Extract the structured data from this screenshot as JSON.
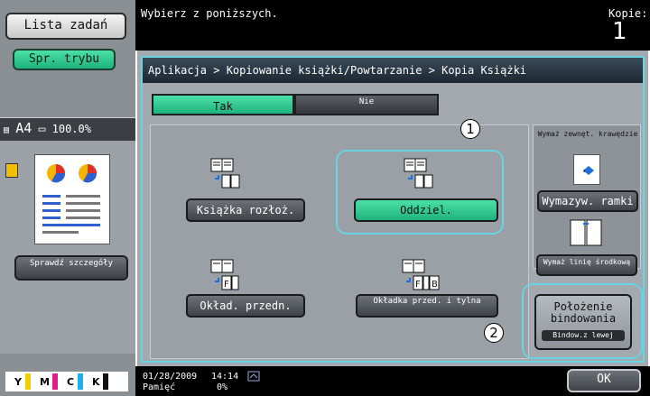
{
  "left": {
    "job_list": "Lista zadań",
    "check_mode": "Spr. trybu",
    "preview": {
      "paper": "A4",
      "zoom": "100.0%"
    },
    "check_details": "Sprawdź szczegóły"
  },
  "top": {
    "message": "Wybierz z poniższych.",
    "copies_label": "Kopie:",
    "copies_value": "1"
  },
  "main": {
    "breadcrumb": "Aplikacja > Kopiowanie książki/Powtarzanie > Kopia Książki",
    "tabs": {
      "yes": "Tak",
      "no": "Nie"
    },
    "options": {
      "spread": "Książka rozłoż.",
      "separate": "Oddziel.",
      "front_cover": "Okład. przedn.",
      "front_back_cover": "Okładka przed. i tylna"
    },
    "side": {
      "erase_edges_label": "Wymaż zewnęt. krawędzie",
      "frame_erase": "Wymazyw. ramki",
      "center_erase": "Wymaż linię środkową",
      "binding_title": "Położenie bindowania",
      "binding_value": "Bindow.z lewej"
    },
    "callouts": [
      "1",
      "2"
    ]
  },
  "bottom": {
    "date": "01/28/2009",
    "time": "14:14",
    "memory_label": "Pamięć",
    "memory_value": "0%",
    "ok": "OK"
  },
  "toners": [
    "Y",
    "M",
    "C",
    "K"
  ],
  "colors": {
    "accent_green": "#2fcf92",
    "highlight_cyan": "#6ad3e1"
  }
}
